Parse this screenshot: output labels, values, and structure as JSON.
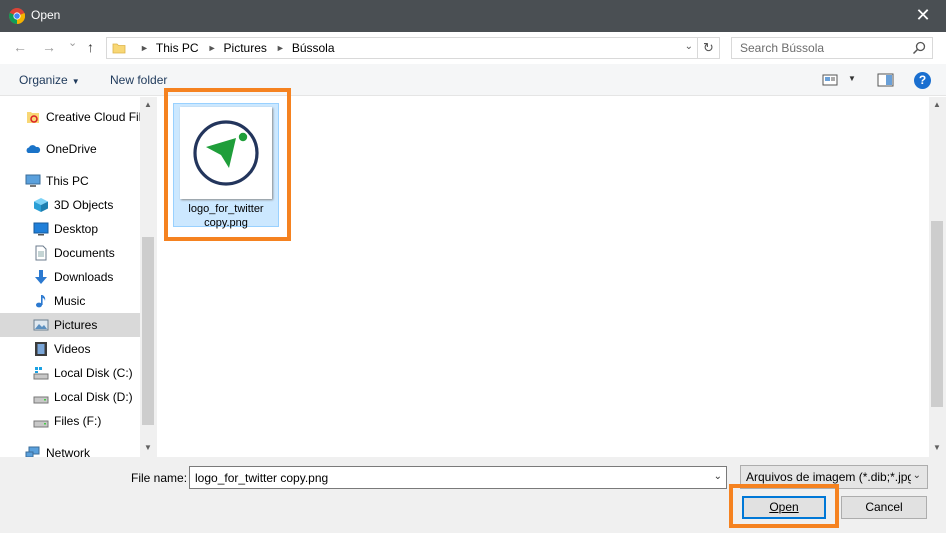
{
  "window": {
    "title": "Open",
    "close_glyph": "✕"
  },
  "nav": {
    "back_glyph": "←",
    "forward_glyph": "→",
    "recent_glyph": "⌄",
    "up_glyph": "↑"
  },
  "address": {
    "crumbs": [
      "This PC",
      "Pictures",
      "Bússola"
    ],
    "dropdown_glyph": "⌄",
    "refresh_glyph": "↻"
  },
  "search": {
    "placeholder": "Search Bússola"
  },
  "toolbar": {
    "organize_label": "Organize",
    "new_folder_label": "New folder",
    "help_glyph": "?"
  },
  "sidebar": {
    "items": [
      {
        "label": "Creative Cloud Files",
        "icon": "creative-cloud-icon"
      },
      {
        "label": "OneDrive",
        "icon": "onedrive-icon"
      },
      {
        "label": "This PC",
        "icon": "this-pc-icon"
      },
      {
        "label": "3D Objects",
        "icon": "3d-objects-icon"
      },
      {
        "label": "Desktop",
        "icon": "desktop-icon"
      },
      {
        "label": "Documents",
        "icon": "documents-icon"
      },
      {
        "label": "Downloads",
        "icon": "downloads-icon"
      },
      {
        "label": "Music",
        "icon": "music-icon"
      },
      {
        "label": "Pictures",
        "icon": "pictures-icon",
        "selected": true
      },
      {
        "label": "Videos",
        "icon": "videos-icon"
      },
      {
        "label": "Local Disk (C:)",
        "icon": "local-disk-c-icon"
      },
      {
        "label": "Local Disk (D:)",
        "icon": "local-disk-d-icon"
      },
      {
        "label": "Files (F:)",
        "icon": "files-drive-icon"
      },
      {
        "label": "Network",
        "icon": "network-icon"
      }
    ]
  },
  "files": [
    {
      "name": "logo_for_twitter copy.png",
      "selected": true
    }
  ],
  "footer": {
    "file_name_label": "File name:",
    "file_name_value": "logo_for_twitter copy.png",
    "file_type_value": "Arquivos de imagem (*.dib;*.jpg",
    "open_label": "Open",
    "cancel_label": "Cancel"
  },
  "colors": {
    "titlebar": "#4a4f53",
    "selection": "#cce8ff",
    "highlight": "#f58220",
    "accent": "#0078d7"
  }
}
